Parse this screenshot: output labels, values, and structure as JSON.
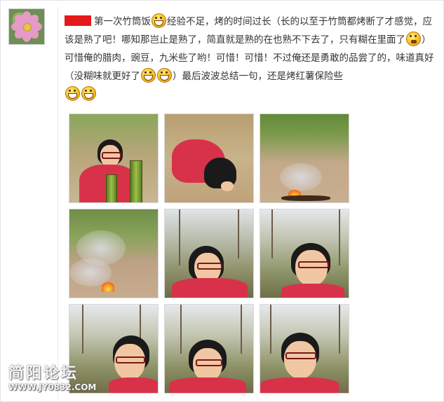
{
  "post": {
    "text_1": "第一次竹筒饭",
    "text_2": "经验不足，烤的时间过长（长的以至于竹筒都烤断了才感觉，应该是熟了吧！哪知那岂止是熟了，简直就是熟的在也熟不下去了，只有糊在里面了",
    "text_3": "）可惜俺的腊肉，豌豆，九米些了哟！可惜！可惜！不过俺还是勇敢的品尝了的，味道真好（没糊味就更好了",
    "text_4": "）最后波波总结一句，还是烤红薯保险些"
  },
  "emoji": {
    "grin": "grin-icon",
    "think": "thinking-icon"
  },
  "colors": {
    "redaction": "#e5191b",
    "jacket": "#d8324a",
    "accent_border": "#e3e3e3"
  },
  "watermark": {
    "title": "简阳论坛",
    "url": "WWW.JY0832.COM"
  }
}
